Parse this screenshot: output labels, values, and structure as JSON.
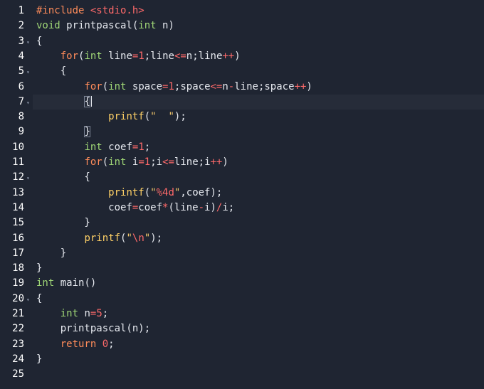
{
  "editor": {
    "lines": [
      {
        "n": "1",
        "fold": false,
        "tokens": [
          [
            "tok-include",
            "#include "
          ],
          [
            "tok-header",
            "<stdio.h>"
          ]
        ]
      },
      {
        "n": "2",
        "fold": false,
        "tokens": [
          [
            "tok-type",
            "void"
          ],
          [
            "tok-ident",
            " printpascal("
          ],
          [
            "tok-type",
            "int"
          ],
          [
            "tok-ident",
            " n)"
          ]
        ]
      },
      {
        "n": "3",
        "fold": true,
        "tokens": [
          [
            "tok-ident",
            "{"
          ]
        ]
      },
      {
        "n": "4",
        "fold": false,
        "tokens": [
          [
            "tok-ident",
            "    "
          ],
          [
            "tok-kw",
            "for"
          ],
          [
            "tok-ident",
            "("
          ],
          [
            "tok-type",
            "int"
          ],
          [
            "tok-ident",
            " line"
          ],
          [
            "tok-op",
            "="
          ],
          [
            "tok-num",
            "1"
          ],
          [
            "tok-ident",
            ";line"
          ],
          [
            "tok-op",
            "<="
          ],
          [
            "tok-ident",
            "n;line"
          ],
          [
            "tok-op",
            "++"
          ],
          [
            "tok-ident",
            ")"
          ]
        ]
      },
      {
        "n": "5",
        "fold": true,
        "tokens": [
          [
            "tok-ident",
            "    {"
          ]
        ]
      },
      {
        "n": "6",
        "fold": false,
        "tokens": [
          [
            "tok-ident",
            "        "
          ],
          [
            "tok-kw",
            "for"
          ],
          [
            "tok-ident",
            "("
          ],
          [
            "tok-type",
            "int"
          ],
          [
            "tok-ident",
            " space"
          ],
          [
            "tok-op",
            "="
          ],
          [
            "tok-num",
            "1"
          ],
          [
            "tok-ident",
            ";space"
          ],
          [
            "tok-op",
            "<="
          ],
          [
            "tok-ident",
            "n"
          ],
          [
            "tok-op",
            "-"
          ],
          [
            "tok-ident",
            "line;space"
          ],
          [
            "tok-op",
            "++"
          ],
          [
            "tok-ident",
            ")"
          ]
        ]
      },
      {
        "n": "7",
        "fold": true,
        "active": true,
        "tokens": [
          [
            "tok-ident",
            "        "
          ],
          [
            "bracket",
            "{"
          ]
        ]
      },
      {
        "n": "8",
        "fold": false,
        "tokens": [
          [
            "tok-ident",
            "            "
          ],
          [
            "tok-fn",
            "printf"
          ],
          [
            "tok-ident",
            "("
          ],
          [
            "tok-str",
            "\"  \""
          ],
          [
            "tok-ident",
            ");"
          ]
        ]
      },
      {
        "n": "9",
        "fold": false,
        "tokens": [
          [
            "tok-ident",
            "        "
          ],
          [
            "bracket",
            "}"
          ]
        ]
      },
      {
        "n": "10",
        "fold": false,
        "tokens": [
          [
            "tok-ident",
            "        "
          ],
          [
            "tok-type",
            "int"
          ],
          [
            "tok-ident",
            " coef"
          ],
          [
            "tok-op",
            "="
          ],
          [
            "tok-num",
            "1"
          ],
          [
            "tok-ident",
            ";"
          ]
        ]
      },
      {
        "n": "11",
        "fold": false,
        "tokens": [
          [
            "tok-ident",
            "        "
          ],
          [
            "tok-kw",
            "for"
          ],
          [
            "tok-ident",
            "("
          ],
          [
            "tok-type",
            "int"
          ],
          [
            "tok-ident",
            " i"
          ],
          [
            "tok-op",
            "="
          ],
          [
            "tok-num",
            "1"
          ],
          [
            "tok-ident",
            ";i"
          ],
          [
            "tok-op",
            "<="
          ],
          [
            "tok-ident",
            "line;i"
          ],
          [
            "tok-op",
            "++"
          ],
          [
            "tok-ident",
            ")"
          ]
        ]
      },
      {
        "n": "12",
        "fold": true,
        "tokens": [
          [
            "tok-ident",
            "        {"
          ]
        ]
      },
      {
        "n": "13",
        "fold": false,
        "tokens": [
          [
            "tok-ident",
            "            "
          ],
          [
            "tok-fn",
            "printf"
          ],
          [
            "tok-ident",
            "("
          ],
          [
            "tok-str",
            "\""
          ],
          [
            "tok-esc",
            "%4d"
          ],
          [
            "tok-str",
            "\""
          ],
          [
            "tok-ident",
            ",coef);"
          ]
        ]
      },
      {
        "n": "14",
        "fold": false,
        "tokens": [
          [
            "tok-ident",
            "            coef"
          ],
          [
            "tok-op",
            "="
          ],
          [
            "tok-ident",
            "coef"
          ],
          [
            "tok-op",
            "*"
          ],
          [
            "tok-ident",
            "(line"
          ],
          [
            "tok-op",
            "-"
          ],
          [
            "tok-ident",
            "i)"
          ],
          [
            "tok-op",
            "/"
          ],
          [
            "tok-ident",
            "i;"
          ]
        ]
      },
      {
        "n": "15",
        "fold": false,
        "tokens": [
          [
            "tok-ident",
            "        }"
          ]
        ]
      },
      {
        "n": "16",
        "fold": false,
        "tokens": [
          [
            "tok-ident",
            "        "
          ],
          [
            "tok-fn",
            "printf"
          ],
          [
            "tok-ident",
            "("
          ],
          [
            "tok-str",
            "\""
          ],
          [
            "tok-esc",
            "\\n"
          ],
          [
            "tok-str",
            "\""
          ],
          [
            "tok-ident",
            ");"
          ]
        ]
      },
      {
        "n": "17",
        "fold": false,
        "tokens": [
          [
            "tok-ident",
            "    }"
          ]
        ]
      },
      {
        "n": "18",
        "fold": false,
        "tokens": [
          [
            "tok-ident",
            "}"
          ]
        ]
      },
      {
        "n": "19",
        "fold": false,
        "tokens": [
          [
            "tok-type",
            "int"
          ],
          [
            "tok-ident",
            " main()"
          ]
        ]
      },
      {
        "n": "20",
        "fold": true,
        "tokens": [
          [
            "tok-ident",
            "{"
          ]
        ]
      },
      {
        "n": "21",
        "fold": false,
        "tokens": [
          [
            "tok-ident",
            "    "
          ],
          [
            "tok-type",
            "int"
          ],
          [
            "tok-ident",
            " n"
          ],
          [
            "tok-op",
            "="
          ],
          [
            "tok-num",
            "5"
          ],
          [
            "tok-ident",
            ";"
          ]
        ]
      },
      {
        "n": "22",
        "fold": false,
        "tokens": [
          [
            "tok-ident",
            "    printpascal(n);"
          ]
        ]
      },
      {
        "n": "23",
        "fold": false,
        "tokens": [
          [
            "tok-ident",
            "    "
          ],
          [
            "tok-kw",
            "return"
          ],
          [
            "tok-ident",
            " "
          ],
          [
            "tok-num",
            "0"
          ],
          [
            "tok-ident",
            ";"
          ]
        ]
      },
      {
        "n": "24",
        "fold": false,
        "tokens": [
          [
            "tok-ident",
            "}"
          ]
        ]
      },
      {
        "n": "25",
        "fold": false,
        "tokens": []
      }
    ],
    "fold_glyph": "▾",
    "colors": {
      "background": "#1f2532",
      "text": "#e6e9ef",
      "keyword": "#ff8c5a",
      "type": "#9fd676",
      "number": "#ff6a6a",
      "string": "#f3c76b",
      "function": "#ffd166",
      "active_line": "#262c39"
    }
  }
}
